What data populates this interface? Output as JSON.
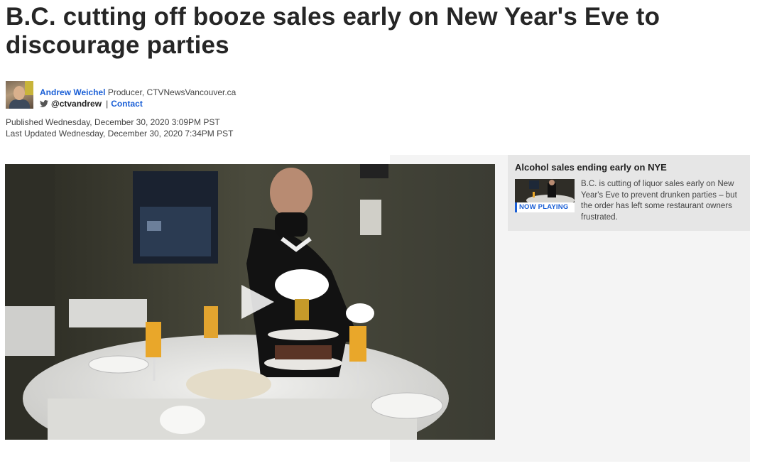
{
  "article": {
    "headline": "B.C. cutting off booze sales early on New Year's Eve to discourage parties",
    "author_name": "Andrew Weichel",
    "author_role": "Producer, CTVNewsVancouver.ca",
    "twitter_handle": "@ctvandrew",
    "contact_label": "Contact",
    "published": "Published Wednesday, December 30, 2020 3:09PM PST",
    "updated": "Last Updated Wednesday, December 30, 2020 7:34PM PST"
  },
  "playlist": {
    "title": "Alcohol sales ending early on NYE",
    "now_playing_label": "NOW PLAYING",
    "description": "B.C. is cutting of liquor sales early on New Year's Eve to prevent drunken parties – but the order has left some restaurant owners frustrated."
  },
  "icons": {
    "twitter": "twitter-icon",
    "play": "play-icon"
  },
  "colors": {
    "link_blue": "#1a5fd6",
    "sidebar_bg": "#f4f4f4",
    "playlist_bg": "#e6e6e6"
  }
}
